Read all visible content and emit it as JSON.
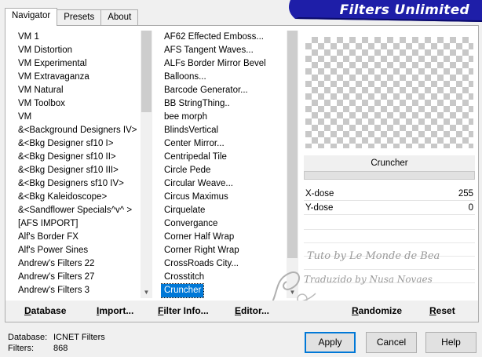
{
  "tabs": [
    "Navigator",
    "Presets",
    "About"
  ],
  "banner": {
    "title": "Filters Unlimited",
    "color": "#1e1ea8"
  },
  "categories": [
    "VM 1",
    "VM Distortion",
    "VM Experimental",
    "VM Extravaganza",
    "VM Natural",
    "VM Toolbox",
    "VM",
    "&<Background Designers IV>",
    "&<Bkg Designer sf10 I>",
    "&<Bkg Designer sf10 II>",
    "&<Bkg Designer sf10 III>",
    "&<Bkg Designers sf10 IV>",
    "&<Bkg Kaleidoscope>",
    "&<Sandflower Specials^v^ >",
    "[AFS IMPORT]",
    "Alf's Border FX",
    "Alf's Power Sines",
    "Andrew's Filters 22",
    "Andrew's Filters 27",
    "Andrew's Filters 3"
  ],
  "filters": [
    "AF62 Effected Emboss...",
    "AFS Tangent Waves...",
    "ALFs Border Mirror Bevel",
    "Balloons...",
    "Barcode Generator...",
    "BB StringThing..",
    "bee morph",
    "BlindsVertical",
    "Center Mirror...",
    "Centripedal Tile",
    "Circle Pede",
    "Circular Weave...",
    "Circus Maximus",
    "Cirquelate",
    "Convergance",
    "Corner Half Wrap",
    "Corner Right Wrap",
    "CrossRoads City...",
    "Crosstitch",
    "Cruncher"
  ],
  "selected_filter": "Cruncher",
  "filter_name": "Cruncher",
  "params": [
    {
      "name": "X-dose",
      "value": "255"
    },
    {
      "name": "Y-dose",
      "value": "0"
    }
  ],
  "watermark": {
    "line1": "Tuto by Le Monde de Bea",
    "line2": "Traduzido by Nusa Novaes"
  },
  "toolbar": {
    "database": "Database",
    "import": "Import...",
    "filter_info": "Filter Info...",
    "editor": "Editor...",
    "randomize": "Randomize",
    "reset": "Reset"
  },
  "footer": {
    "database_label": "Database:",
    "database_value": "ICNET Filters",
    "filters_label": "Filters:",
    "filters_value": "868"
  },
  "buttons": {
    "apply": "Apply",
    "cancel": "Cancel",
    "help": "Help"
  }
}
